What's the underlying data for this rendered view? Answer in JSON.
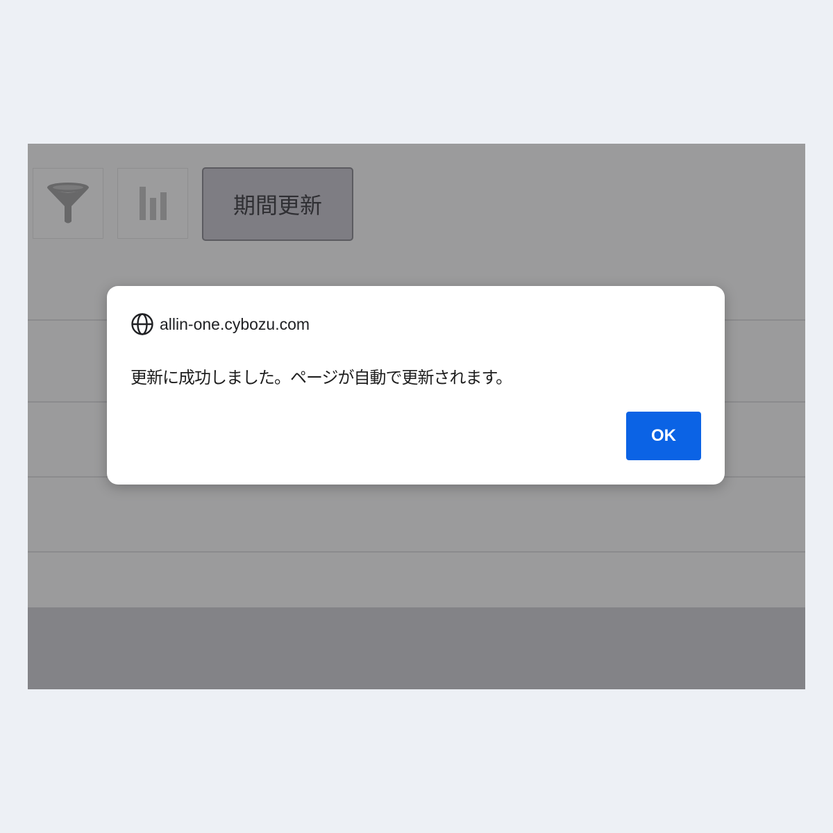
{
  "toolbar": {
    "filter_icon": "funnel-icon",
    "graph_icon": "bar-chart-icon",
    "period_update_label": "期間更新"
  },
  "dialog": {
    "origin_icon": "globe-icon",
    "origin": "allin-one.cybozu.com",
    "message": "更新に成功しました。ページが自動で更新されます。",
    "ok_label": "OK"
  },
  "colors": {
    "overlay_background": "#9b9b9c",
    "dialog_background": "#ffffff",
    "ok_button": "#0b63e5",
    "page_background": "#edf0f5"
  }
}
